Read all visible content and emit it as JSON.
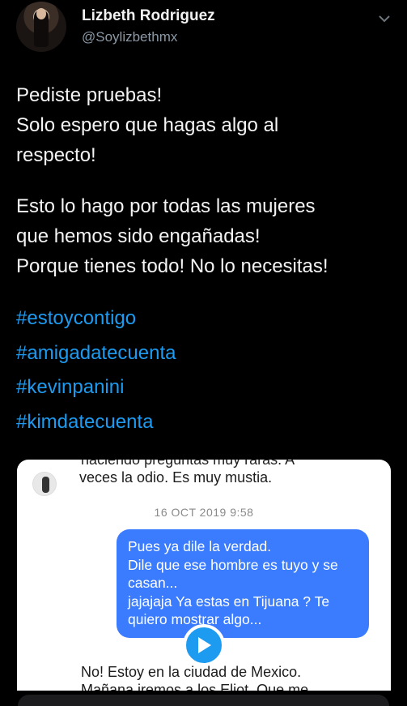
{
  "header": {
    "name": "Lizbeth Rodriguez",
    "handle": "@Soylizbethmx"
  },
  "tweet": {
    "para1": [
      "Pediste pruebas!",
      "Solo espero que hagas algo al",
      "respecto!"
    ],
    "para2": [
      "Esto lo hago por todas las mujeres",
      "que hemos sido engañadas!",
      "Porque tienes todo! No lo necesitas!"
    ],
    "hashtags": [
      "#estoycontigo",
      "#amigadatecuenta",
      "#kevinpanini",
      "#kimdatecuenta"
    ]
  },
  "media": {
    "cut_line": "haciendo preguntas muy raras. A",
    "msg1": "veces la odio. Es muy mustia.",
    "timestamp": "16 OCT 2019 9:58",
    "bubble": [
      "Pues ya dile la verdad.",
      "Dile que ese hombre es tuyo y se",
      "casan...",
      "jajajaja Ya estas en Tijuana ? Te",
      "quiero mostrar algo..."
    ],
    "msg2": "No! Estoy en la ciudad de Mexico.",
    "msg3": "Mañana iremos a los Eliot. Que me"
  },
  "colors": {
    "hashtag": "#1d9bf0",
    "bubble": "#3b7cff",
    "play": "#1d9bf0"
  },
  "icons": [
    "chevron-down-icon",
    "play-icon"
  ]
}
